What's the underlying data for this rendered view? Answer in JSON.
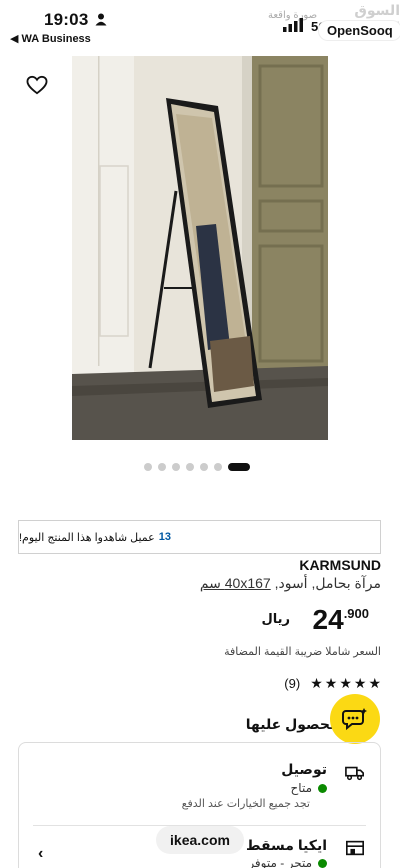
{
  "status_bar": {
    "time": "19:03",
    "back_app": "◀ WA Business",
    "network": "5G",
    "faint_text": "صورة واقعة"
  },
  "watermark": {
    "arabic": "السوق المفتوح",
    "logo": "OpenSooq"
  },
  "product": {
    "favorite_icon": "heart-icon",
    "gallery": {
      "total": 7,
      "active_index": 6
    },
    "viewers_count": "13",
    "viewers_text": "عميل شاهدوا هذا المنتج اليوم!",
    "brand": "KARMSUND",
    "description_prefix": "مرآة بحامل, أسود, ",
    "size": "40x167 سم",
    "price": {
      "integer": "24",
      "decimal": ".900",
      "currency": "ريال"
    },
    "vat_note": "السعر شاملا ضريبة القيمة المضافة",
    "rating": {
      "stars": 5,
      "count": "(9)"
    }
  },
  "availability": {
    "title": "الحصول عليها",
    "delivery": {
      "title": "توصيل",
      "status": "متاح",
      "note": "تجد جميع الخيارات عند الدفع"
    },
    "store": {
      "title": "ايكيا مسقط",
      "status": "متجر - متوفر"
    }
  },
  "browser": {
    "url": "ikea.com",
    "back": "‹"
  },
  "colors": {
    "accent_blue": "#0058a3",
    "chat_yellow": "#fbd914",
    "available_green": "#0a8a00"
  }
}
